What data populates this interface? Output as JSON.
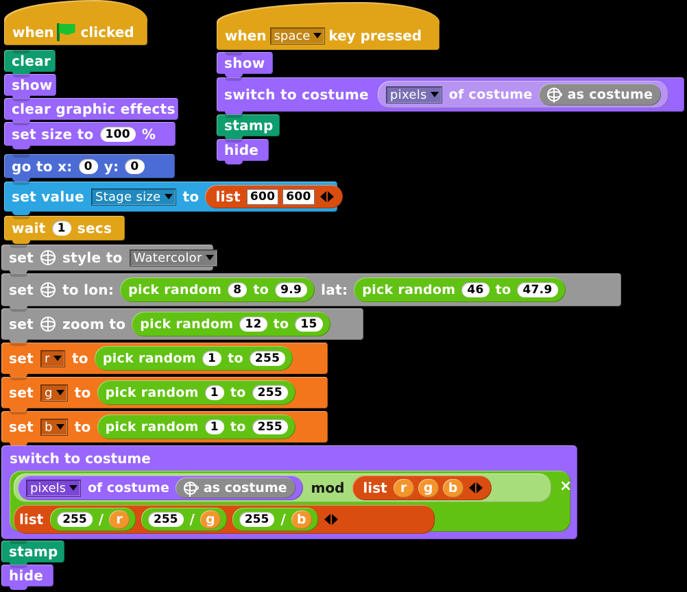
{
  "app": {
    "kind": "visual-block-programming-canvas",
    "background": "#000000"
  },
  "palette": {
    "looks": "#9966ff",
    "pen": "#0e9d6e",
    "motion": "#4a6cd4",
    "control": "#e1a419",
    "variables": "#f3761d",
    "sensing": "#2ca5e2",
    "operators": "#62c213",
    "list": "#d94d11",
    "other": "#989898"
  },
  "scripts": {
    "script1": {
      "hat": {
        "prefix": "when",
        "icon": "green-flag-icon",
        "suffix": "clicked"
      },
      "blocks": {
        "clear": {
          "label": "clear"
        },
        "show": {
          "label": "show"
        },
        "clear_fx": {
          "label": "clear graphic effects"
        },
        "set_size": {
          "pre": "set size to",
          "value": "100",
          "post": "%"
        },
        "go_to": {
          "pre": "go to x:",
          "x": "0",
          "mid": "y:",
          "y": "0"
        },
        "set_value": {
          "pre": "set value",
          "dropdown": "Stage size",
          "mid": "to",
          "list_label": "list",
          "item1": "600",
          "item2": "600"
        },
        "wait": {
          "pre": "wait",
          "value": "1",
          "post": "secs"
        },
        "set_style": {
          "pre": "set",
          "icon": "globe-icon",
          "mid": "style to",
          "dropdown": "Watercolor"
        },
        "set_lonlat": {
          "pre": "set",
          "icon": "globe-icon",
          "mid": "to lon:",
          "lon": {
            "label": "pick random",
            "from": "8",
            "to_label": "to",
            "to": "9.9"
          },
          "lat_label": "lat:",
          "lat": {
            "label": "pick random",
            "from": "46",
            "to_label": "to",
            "to": "47.9"
          }
        },
        "set_zoom": {
          "pre": "set",
          "icon": "globe-icon",
          "mid": "zoom to",
          "random": {
            "label": "pick random",
            "from": "12",
            "to_label": "to",
            "to": "15"
          }
        },
        "set_r": {
          "pre": "set",
          "var": "r",
          "mid": "to",
          "random": {
            "label": "pick random",
            "from": "1",
            "to_label": "to",
            "to": "255"
          }
        },
        "set_g": {
          "pre": "set",
          "var": "g",
          "mid": "to",
          "random": {
            "label": "pick random",
            "from": "1",
            "to_label": "to",
            "to": "255"
          }
        },
        "set_b": {
          "pre": "set",
          "var": "b",
          "mid": "to",
          "random": {
            "label": "pick random",
            "from": "1",
            "to_label": "to",
            "to": "255"
          }
        },
        "switch_costume_big": {
          "title": "switch to costume",
          "pixels_dropdown": "pixels",
          "of_costume": "of costume",
          "globe_icon": "globe-icon",
          "as_costume": "as costume",
          "mod_label": "mod",
          "mod_list_label": "list",
          "mod_items": [
            "r",
            "g",
            "b"
          ],
          "multiply_symbol": "×",
          "div_list_label": "list",
          "div_items": [
            {
              "numerator": "255",
              "op": "/",
              "denominator": "r"
            },
            {
              "numerator": "255",
              "op": "/",
              "denominator": "g"
            },
            {
              "numerator": "255",
              "op": "/",
              "denominator": "b"
            }
          ]
        },
        "stamp": {
          "label": "stamp"
        },
        "hide": {
          "label": "hide"
        }
      }
    },
    "script2": {
      "hat": {
        "prefix": "when",
        "dropdown": "space",
        "suffix": "key pressed"
      },
      "blocks": {
        "show": {
          "label": "show"
        },
        "switch_costume": {
          "pre": "switch to costume",
          "pixels_dropdown": "pixels",
          "of_costume": "of costume",
          "globe_icon": "globe-icon",
          "as_costume": "as costume"
        },
        "stamp": {
          "label": "stamp"
        },
        "hide": {
          "label": "hide"
        }
      }
    }
  }
}
